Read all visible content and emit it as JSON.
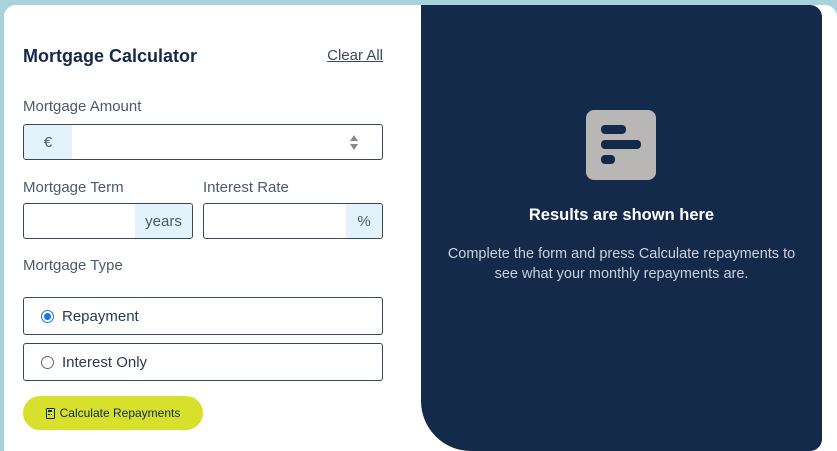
{
  "form": {
    "title": "Mortgage Calculator",
    "clear_all": "Clear All",
    "amount_label": "Mortgage Amount",
    "amount_prefix": "€",
    "amount_value": "",
    "term_label": "Mortgage Term",
    "term_suffix": "years",
    "term_value": "",
    "rate_label": "Interest Rate",
    "rate_suffix": "%",
    "rate_value": "",
    "type_label": "Mortgage Type",
    "type_options": [
      {
        "label": "Repayment",
        "checked": true
      },
      {
        "label": "Interest Only",
        "checked": false
      }
    ],
    "calculate_label": "Calculate Repayments"
  },
  "results": {
    "title": "Results are shown here",
    "description": "Complete the form and press Calculate repayments to see what your monthly repayments are."
  },
  "colors": {
    "page_bg": "#a9d3da",
    "panel_dark": "#142a4b",
    "accent_lime": "#d7e02a",
    "input_addon": "#e3f2fb"
  }
}
